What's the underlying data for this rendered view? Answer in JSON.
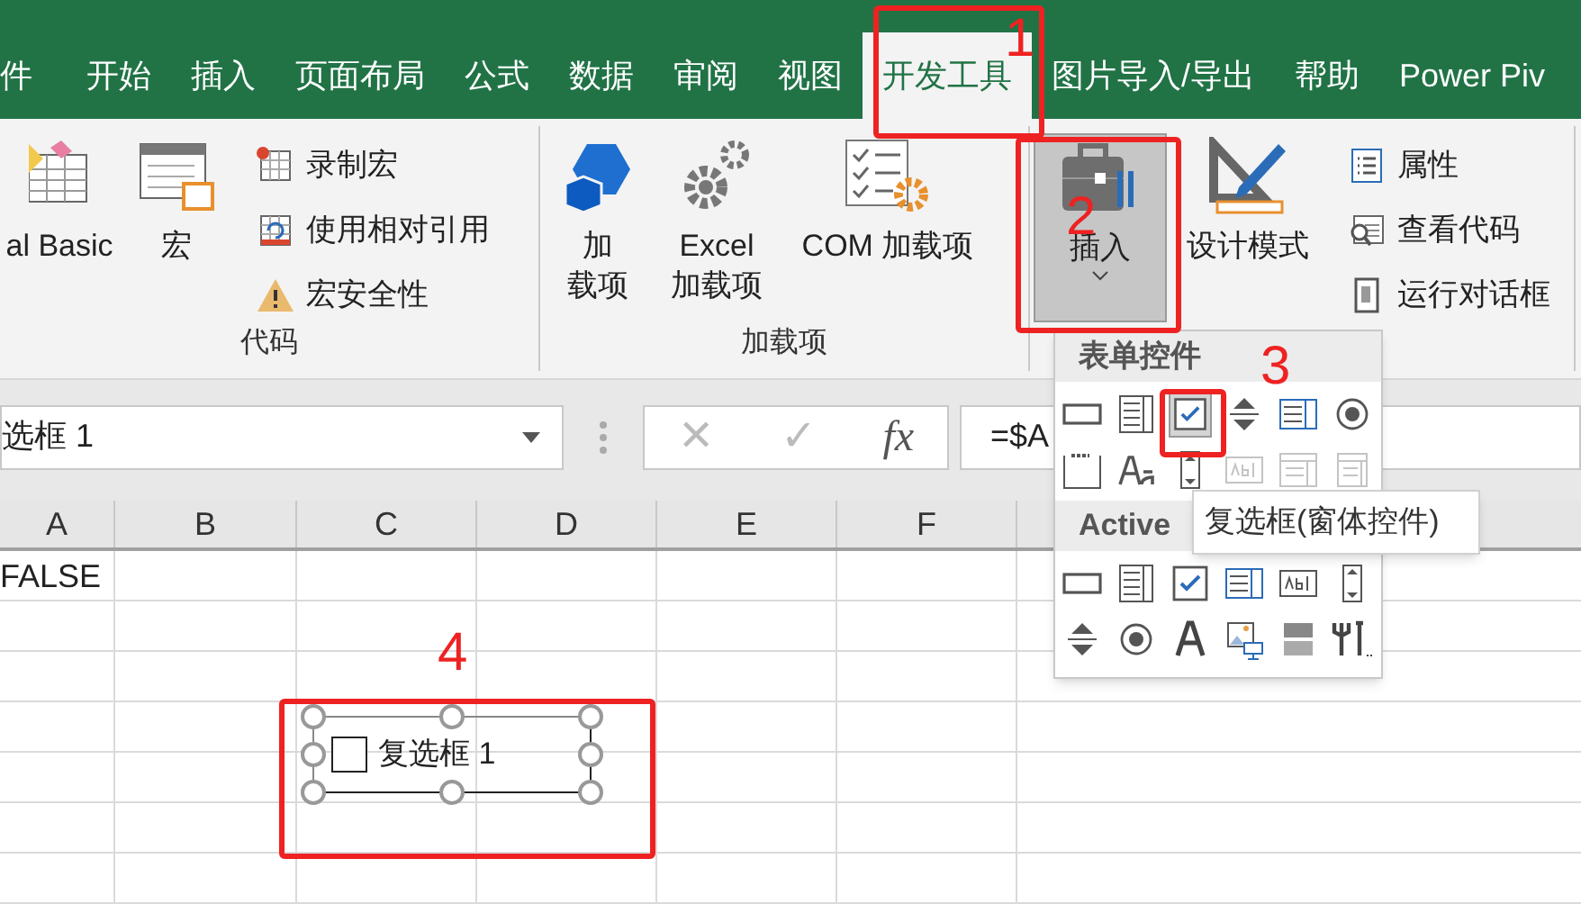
{
  "ribbon_tabs": [
    {
      "label": "件",
      "selected": false
    },
    {
      "label": "开始",
      "selected": false
    },
    {
      "label": "插入",
      "selected": false
    },
    {
      "label": "页面布局",
      "selected": false
    },
    {
      "label": "公式",
      "selected": false
    },
    {
      "label": "数据",
      "selected": false
    },
    {
      "label": "审阅",
      "selected": false
    },
    {
      "label": "视图",
      "selected": false
    },
    {
      "label": "开发工具",
      "selected": true
    },
    {
      "label": "图片导入/导出",
      "selected": false
    },
    {
      "label": "帮助",
      "selected": false
    },
    {
      "label": "Power Piv",
      "selected": false
    }
  ],
  "ribbon_groups": [
    {
      "label": "代码",
      "large_buttons": [
        {
          "label": "al Basic",
          "pressed": false
        },
        {
          "label": "宏",
          "pressed": false
        }
      ],
      "small_buttons": [
        "录制宏",
        "使用相对引用",
        "宏安全性"
      ]
    },
    {
      "label": "加载项",
      "large_buttons": [
        {
          "lines": [
            "加",
            "载项"
          ],
          "pressed": false
        },
        {
          "lines": [
            "Excel",
            "加载项"
          ],
          "pressed": false
        },
        {
          "lines": [
            "COM 加载项"
          ],
          "pressed": false
        }
      ]
    },
    {
      "large_buttons": [
        {
          "label": "插入",
          "pressed": true
        },
        {
          "label": "设计模式",
          "pressed": false
        }
      ],
      "small_buttons": [
        "属性",
        "查看代码",
        "运行对话框"
      ]
    }
  ],
  "name_box": {
    "value": "选框 1"
  },
  "formula_bar": {
    "buttons": [
      "✕",
      "✓",
      "fx"
    ],
    "value": "=$A"
  },
  "sheet": {
    "columns": [
      "A",
      "B",
      "C",
      "D",
      "E",
      "F"
    ],
    "rows": [
      [
        "FALSE"
      ]
    ]
  },
  "insert_menu": {
    "sections": [
      {
        "title": "表单控件",
        "controls": [
          {
            "kind": "button",
            "disabled": false,
            "selected": false
          },
          {
            "kind": "combo",
            "disabled": false,
            "selected": false
          },
          {
            "kind": "checkbox",
            "disabled": false,
            "selected": true
          },
          {
            "kind": "spin",
            "disabled": false,
            "selected": false
          },
          {
            "kind": "listbox",
            "disabled": false,
            "selected": false
          },
          {
            "kind": "option",
            "disabled": false,
            "selected": false
          },
          {
            "kind": "group",
            "disabled": false,
            "selected": false
          },
          {
            "kind": "label",
            "disabled": false,
            "selected": false
          },
          {
            "kind": "scrollbar",
            "disabled": false,
            "selected": false
          },
          {
            "kind": "textfield",
            "disabled": true,
            "selected": false
          },
          {
            "kind": "combo-edit",
            "disabled": true,
            "selected": false
          },
          {
            "kind": "combo-drop",
            "disabled": true,
            "selected": false
          }
        ]
      },
      {
        "title": "Active",
        "controls": [
          {
            "kind": "button",
            "disabled": false,
            "selected": false
          },
          {
            "kind": "combo",
            "disabled": false,
            "selected": false
          },
          {
            "kind": "checkbox",
            "disabled": false,
            "selected": false
          },
          {
            "kind": "listbox",
            "disabled": false,
            "selected": false
          },
          {
            "kind": "textfield",
            "disabled": false,
            "selected": false
          },
          {
            "kind": "scrollbar",
            "disabled": false,
            "selected": false
          },
          {
            "kind": "spin",
            "disabled": false,
            "selected": false
          },
          {
            "kind": "option",
            "disabled": false,
            "selected": false
          },
          {
            "kind": "label-a",
            "disabled": false,
            "selected": false
          },
          {
            "kind": "image",
            "disabled": false,
            "selected": false
          },
          {
            "kind": "toggle",
            "disabled": false,
            "selected": false
          },
          {
            "kind": "tools",
            "disabled": false,
            "selected": false
          }
        ]
      }
    ]
  },
  "tooltip": {
    "text": "复选框(窗体控件)"
  },
  "sheet_checkbox": {
    "label": "复选框 1",
    "checked": false,
    "selected": true
  },
  "annotations": [
    "1",
    "2",
    "3",
    "4"
  ]
}
